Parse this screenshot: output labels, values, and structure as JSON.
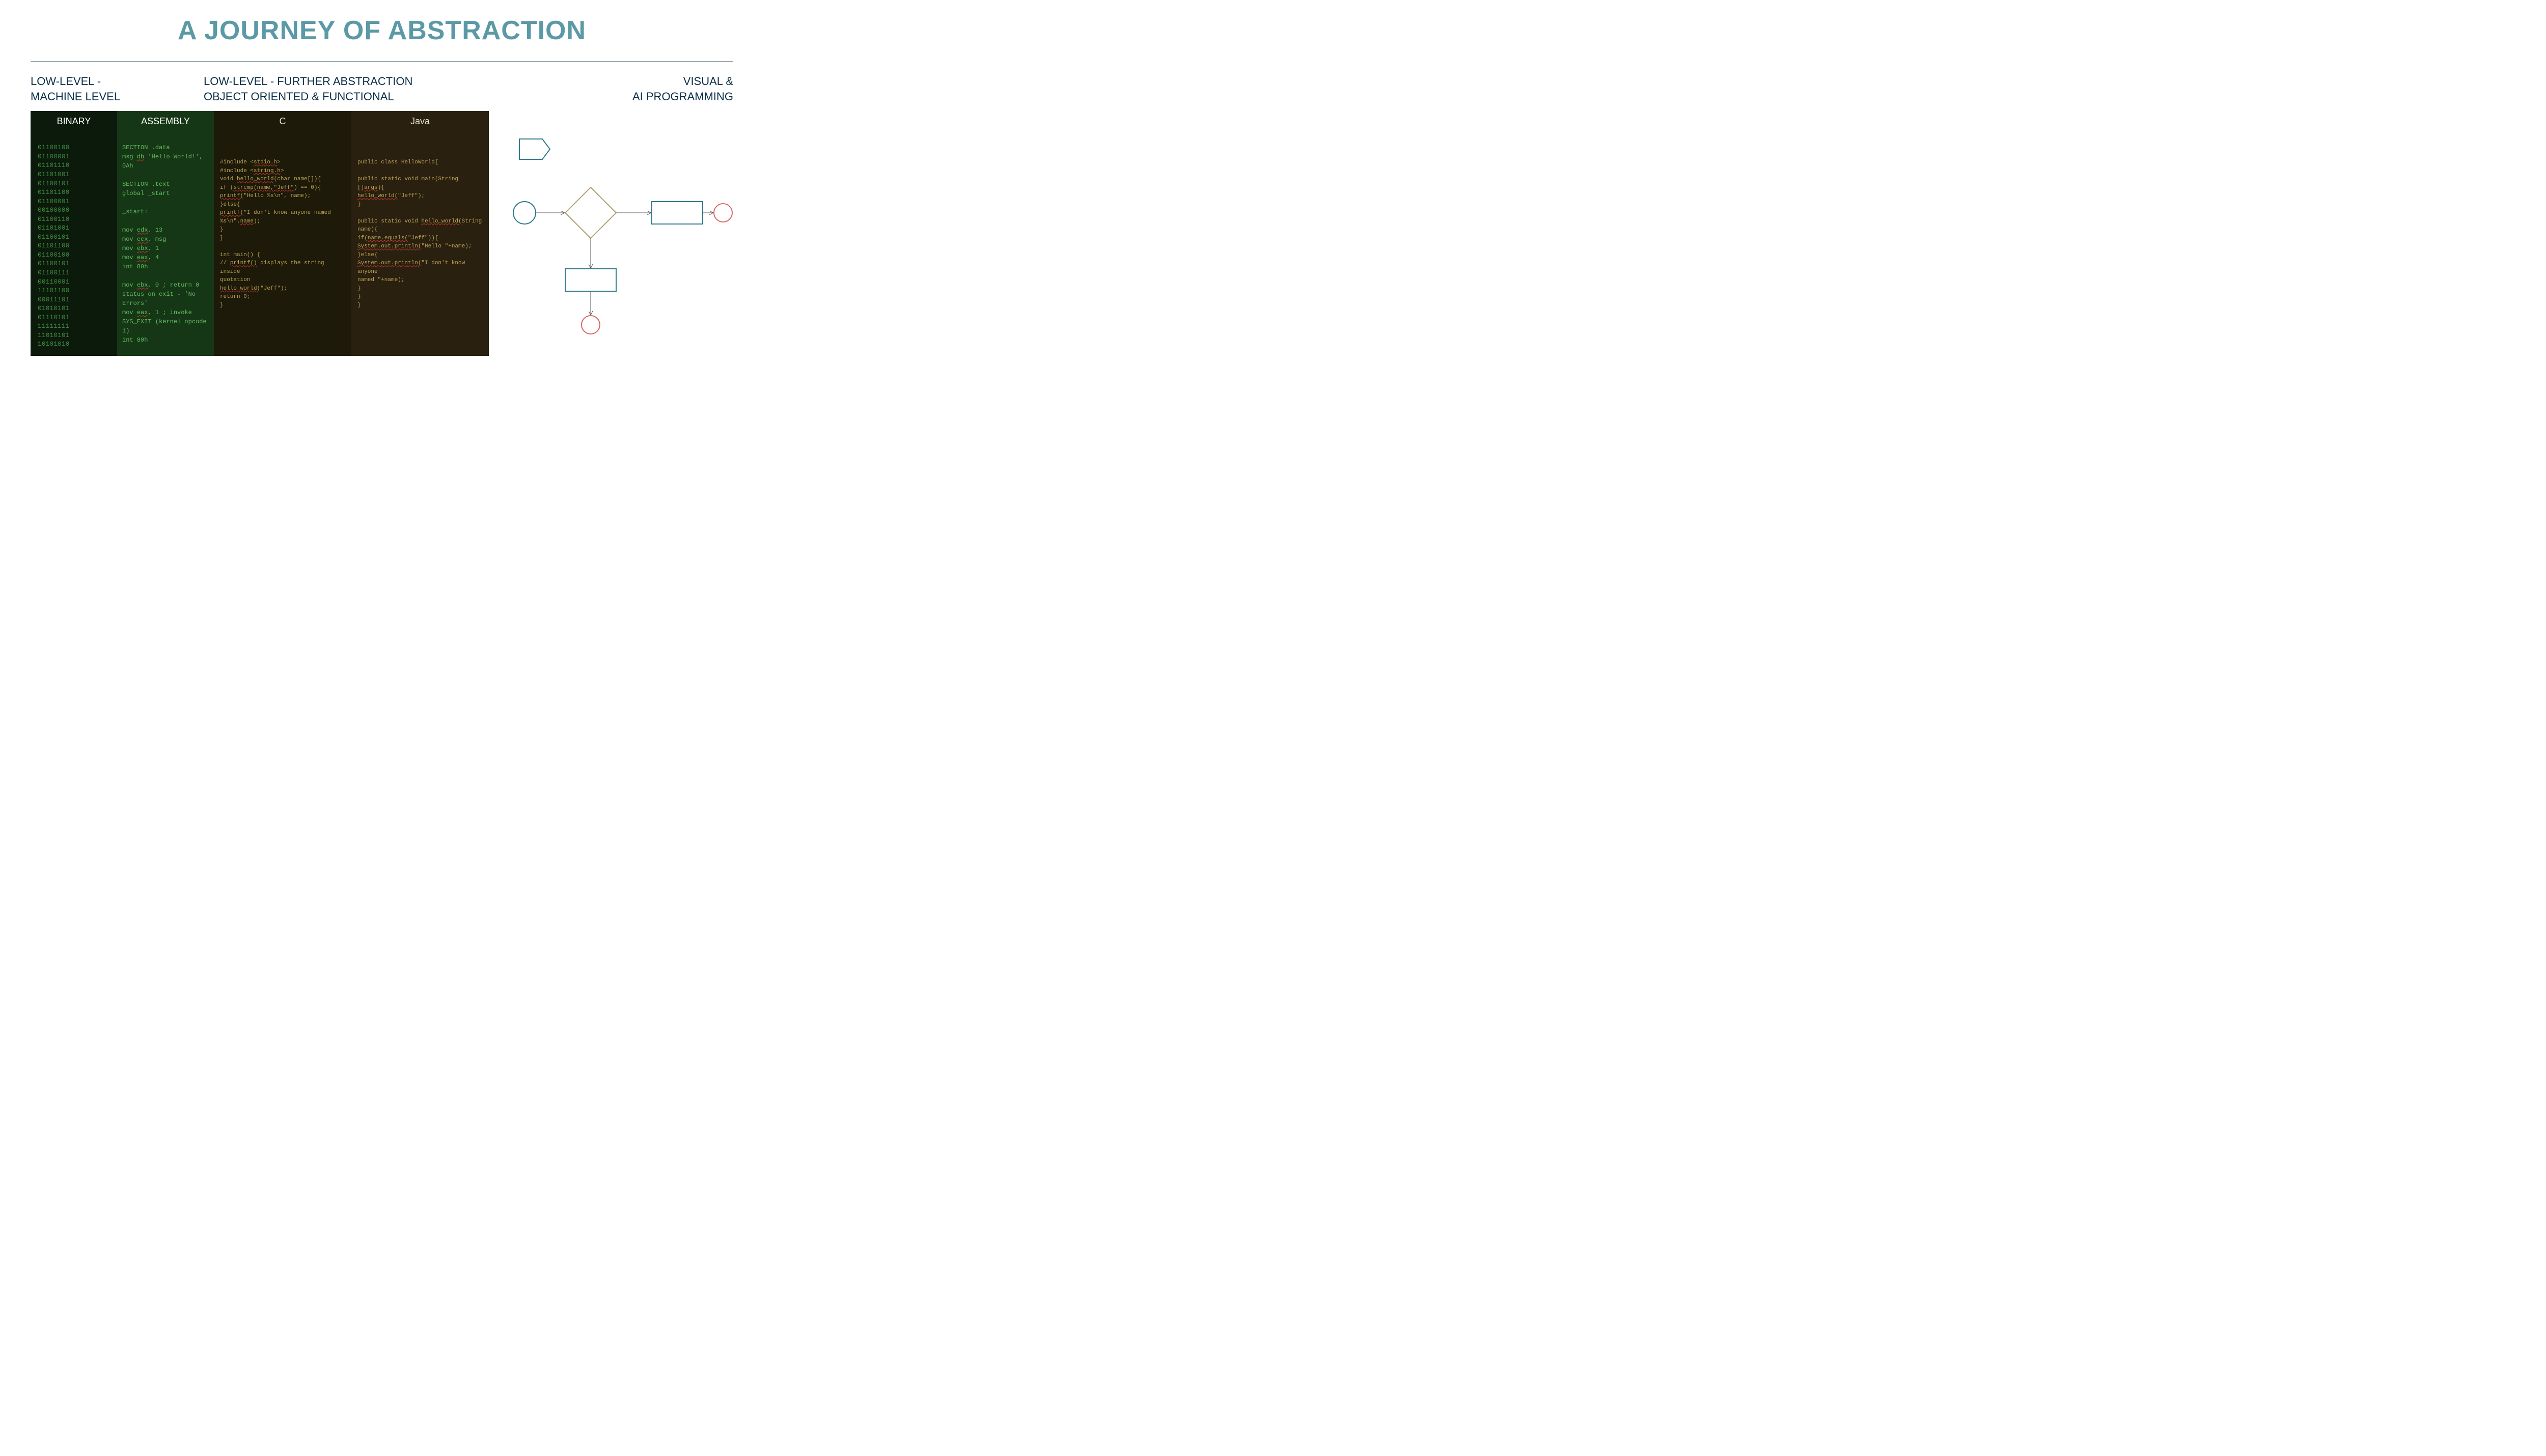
{
  "title": "A JOURNEY OF ABSTRACTION",
  "headers": {
    "col1_line1": "LOW-LEVEL -",
    "col1_line2": "MACHINE LEVEL",
    "col2_line1": "LOW-LEVEL - FURTHER ABSTRACTION",
    "col2_line2": "OBJECT ORIENTED & FUNCTIONAL",
    "col3_line1": "VISUAL &",
    "col3_line2": "AI PROGRAMMING"
  },
  "panels": {
    "binary": {
      "head": "BINARY",
      "lines": [
        "01100100",
        "01100001",
        "01101110",
        "01101001",
        "01100101",
        "01101100",
        "01100001",
        "00100000",
        "01100110",
        "01101001",
        "01100101",
        "01101100",
        "01100100",
        "01100101",
        "01100111",
        "00110001",
        "11101100",
        "00011101",
        "01010101",
        "01110101",
        "11111111",
        "11010101",
        "10101010"
      ]
    },
    "assembly": {
      "head": "ASSEMBLY",
      "lines": [
        "SECTION .data",
        "msg   <u>db</u>   'Hello World!',",
        "0Ah",
        "",
        "SECTION .text",
        "global  _start",
        "",
        "_start:",
        "",
        "   mov   <u>edx</u>, 13",
        "   mov   <u>ecx</u>, msg",
        "   mov   <u>ebx</u>, 1",
        "   mov   <u>eax</u>, 4",
        "   int   80h",
        "",
        "   mov   <u>ebx</u>, 0    ; return 0",
        "status on exit - 'No Errors'",
        "   mov   <u>eax</u>, 1    ; invoke",
        "SYS_EXIT (kernel opcode 1)",
        "   int   80h"
      ]
    },
    "c": {
      "head": "C",
      "lines": [
        "#include <<u>stdio.h</u>>",
        "#include <<u>string.h</u>>",
        "void <u>hello_world</u>(char name[]){",
        "   if (<u>strcmp(name,\"Jeff\"</u>) == 0){",
        "      <u>printf(</u>\"Hello %s\\n\", name);",
        "   }else{",
        "      <u>printf(</u>\"I don't know anyone named",
        "%s\\n\".<u>name</u>);",
        "   }",
        "}",
        "",
        "int main() {",
        "  // <u>printf()</u> displays the string inside",
        "quotation",
        "   <u>hello_world(</u>\"Jeff\");",
        "   return 0;",
        "}"
      ]
    },
    "java": {
      "head": "Java",
      "lines": [
        "public class HelloWorld{",
        "",
        "   public static void main(String []<u>args</u>){",
        "      <u>hello_world(</u>\"Jeff\");",
        "   }",
        "",
        "   public static void <u>hello_world(</u>String name){",
        "      if(<u>name.equals(</u>\"Jeff\")){",
        "         <u>System.out.println(</u>\"Hello \"+name);",
        "      }else{",
        "         <u>System.out.println(</u>\"I don't know anyone",
        "named \"+name);",
        "      }",
        "    }",
        "}"
      ]
    }
  }
}
